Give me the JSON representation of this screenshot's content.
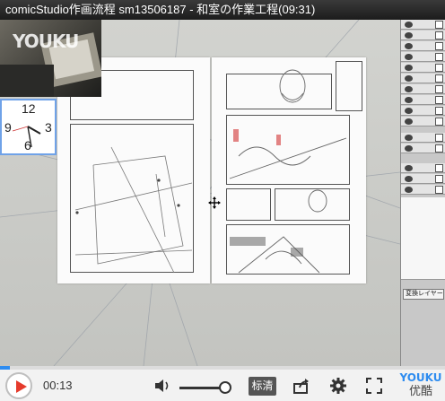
{
  "title": "comicStudio作画流程 sm13506187 - 和室の作業工程(09:31)",
  "watermark": {
    "logo": "YOUKU"
  },
  "clock": {
    "n12": "12",
    "n3": "3",
    "n6": "6",
    "n9": "9"
  },
  "palette": {
    "bottom_label": "変換レイヤー"
  },
  "player": {
    "current_time": "00:13",
    "quality_label": "标清",
    "progress_fraction": 0.023,
    "brand_top": "YOUKU",
    "brand_bottom": "优酷"
  },
  "colors": {
    "accent": "#2e8cf0",
    "play": "#e53b2c"
  }
}
